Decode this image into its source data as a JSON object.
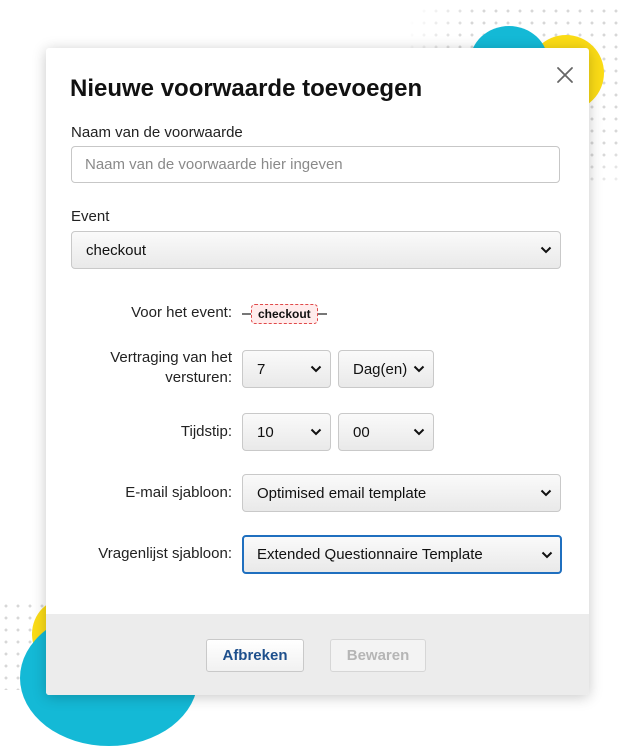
{
  "dialog": {
    "title": "Nieuwe voorwaarde toevoegen",
    "close_icon": "close-icon"
  },
  "name_field": {
    "label": "Naam van de voorwaarde",
    "value": "",
    "placeholder": "Naam van de voorwaarde hier ingeven"
  },
  "event_field": {
    "label": "Event",
    "selected": "checkout"
  },
  "before_event": {
    "label": "Voor het event:",
    "chip": "checkout"
  },
  "delay": {
    "label": "Vertraging van het versturen:",
    "amount": "7",
    "unit": "Dag(en)"
  },
  "time": {
    "label": "Tijdstip:",
    "hour": "10",
    "minute": "00"
  },
  "email_template": {
    "label": "E-mail sjabloon:",
    "selected": "Optimised email template"
  },
  "questionnaire_template": {
    "label": "Vragenlijst sjabloon:",
    "selected": "Extended Questionnaire Template"
  },
  "footer": {
    "cancel_label": "Afbreken",
    "save_label": "Bewaren"
  },
  "colors": {
    "accent_blue": "#1f6fbf",
    "cancel_text": "#1d4f8c",
    "chip_border": "#e04a4a",
    "deco_cyan": "#14b9d6",
    "deco_yellow": "#fbdc16"
  }
}
